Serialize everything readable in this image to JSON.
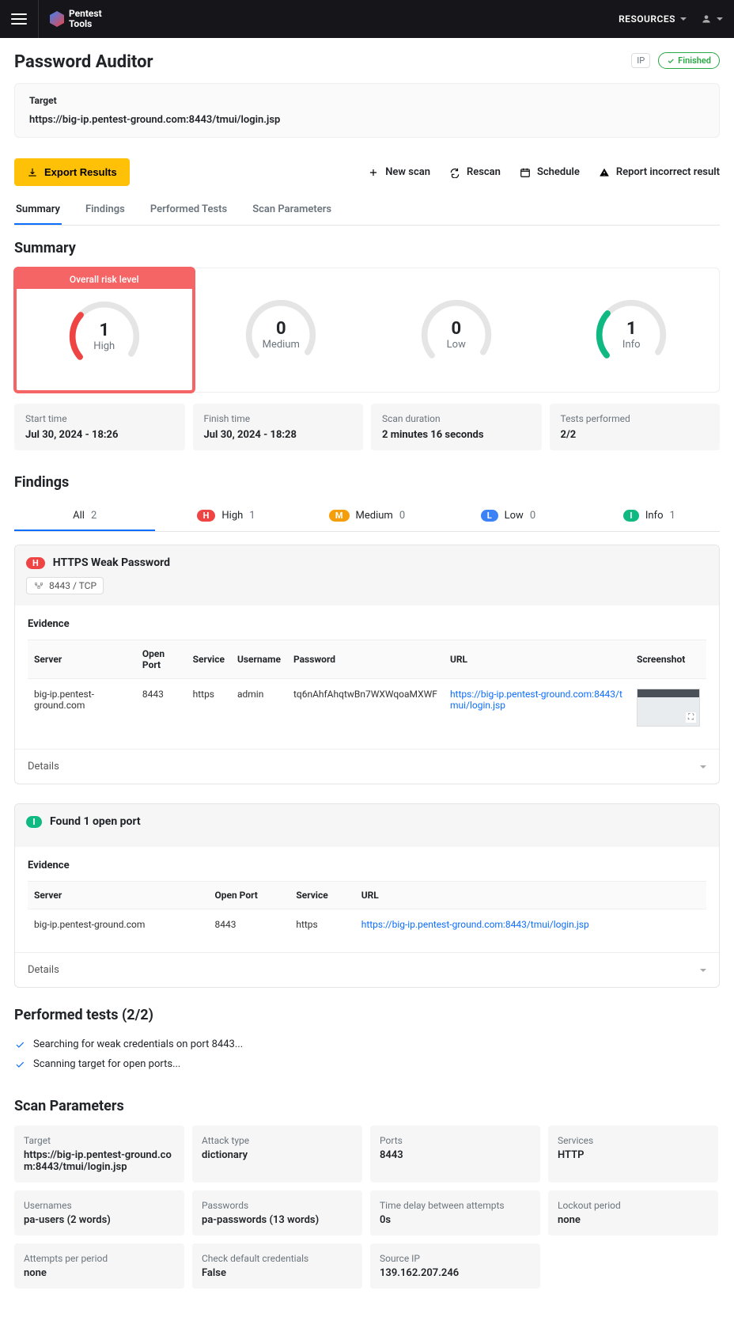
{
  "nav": {
    "resources": "RESOURCES",
    "logo": "Pentest\nTools"
  },
  "page": {
    "title": "Password Auditor",
    "ip_badge": "IP",
    "status": "Finished",
    "target_label": "Target",
    "target_url": "https://big-ip.pentest-ground.com:8443/tmui/login.jsp",
    "export": "Export Results",
    "actions": {
      "new_scan": "New scan",
      "rescan": "Rescan",
      "schedule": "Schedule",
      "report": "Report incorrect result"
    }
  },
  "tabs": {
    "summary": "Summary",
    "findings": "Findings",
    "tests": "Performed Tests",
    "params": "Scan Parameters"
  },
  "summary": {
    "heading": "Summary",
    "overall_label": "Overall risk level",
    "risk": [
      {
        "count": "1",
        "label": "High",
        "color": "#ef4444"
      },
      {
        "count": "0",
        "label": "Medium",
        "color": "#e5e5e5"
      },
      {
        "count": "0",
        "label": "Low",
        "color": "#e5e5e5"
      },
      {
        "count": "1",
        "label": "Info",
        "color": "#10b981"
      }
    ],
    "info": [
      {
        "label": "Start time",
        "value": "Jul 30, 2024 - 18:26"
      },
      {
        "label": "Finish time",
        "value": "Jul 30, 2024 - 18:28"
      },
      {
        "label": "Scan duration",
        "value": "2 minutes 16 seconds"
      },
      {
        "label": "Tests performed",
        "value": "2/2"
      }
    ]
  },
  "findings": {
    "heading": "Findings",
    "filters": [
      {
        "sev": "",
        "label": "All",
        "count": "2"
      },
      {
        "sev": "H",
        "label": "High",
        "count": "1"
      },
      {
        "sev": "M",
        "label": "Medium",
        "count": "0"
      },
      {
        "sev": "L",
        "label": "Low",
        "count": "0"
      },
      {
        "sev": "I",
        "label": "Info",
        "count": "1"
      }
    ],
    "f1": {
      "title": "HTTPS Weak Password",
      "port": "8443 / TCP",
      "evidence": "Evidence",
      "headers": {
        "server": "Server",
        "port": "Open Port",
        "service": "Service",
        "user": "Username",
        "pass": "Password",
        "url": "URL",
        "shot": "Screenshot"
      },
      "row": {
        "server": "big-ip.pentest-ground.com",
        "port": "8443",
        "service": "https",
        "user": "admin",
        "pass": "tq6nAhfAhqtwBn7WXWqoaMXWF",
        "url": "https://big-ip.pentest-ground.com:8443/tmui/login.jsp"
      },
      "details": "Details"
    },
    "f2": {
      "title": "Found 1 open port",
      "evidence": "Evidence",
      "headers": {
        "server": "Server",
        "port": "Open Port",
        "service": "Service",
        "url": "URL"
      },
      "row": {
        "server": "big-ip.pentest-ground.com",
        "port": "8443",
        "service": "https",
        "url": "https://big-ip.pentest-ground.com:8443/tmui/login.jsp"
      },
      "details": "Details"
    }
  },
  "tests": {
    "heading": "Performed tests (2/2)",
    "items": [
      "Searching for weak credentials on port 8443...",
      "Scanning target for open ports..."
    ]
  },
  "params": {
    "heading": "Scan Parameters",
    "items": [
      {
        "label": "Target",
        "value": "https://big-ip.pentest-ground.com:8443/tmui/login.jsp"
      },
      {
        "label": "Attack type",
        "value": "dictionary"
      },
      {
        "label": "Ports",
        "value": "8443"
      },
      {
        "label": "Services",
        "value": "HTTP"
      },
      {
        "label": "Usernames",
        "value": "pa-users (2 words)"
      },
      {
        "label": "Passwords",
        "value": "pa-passwords (13 words)"
      },
      {
        "label": "Time delay between attempts",
        "value": "0s"
      },
      {
        "label": "Lockout period",
        "value": "none"
      },
      {
        "label": "Attempts per period",
        "value": "none"
      },
      {
        "label": "Check default credentials",
        "value": "False"
      },
      {
        "label": "Source IP",
        "value": "139.162.207.246"
      }
    ]
  }
}
